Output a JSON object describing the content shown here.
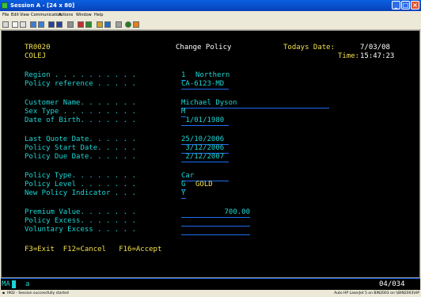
{
  "window": {
    "title": "Session A - [24 x 80]"
  },
  "menu": [
    "File",
    "Edit",
    "View",
    "Communication",
    "Actions",
    "Window",
    "Help"
  ],
  "screen": {
    "program_id": "TR0020",
    "user": "COLEJ",
    "title": "Change Policy",
    "date_label": "Todays Date:",
    "date_value": "7/03/08",
    "time_label": "Time:",
    "time_value": "15:47:23",
    "fields": {
      "region_label": "Region . . . . . . . . . .",
      "region_code": "1",
      "region_name": "Northern",
      "policy_ref_label": "Policy reference . . . . .",
      "policy_ref": "CA-6123-MD",
      "customer_label": "Customer Name. . . . . . .",
      "customer": "Michael Dyson",
      "sex_label": "Sex Type . . . . . . . . .",
      "sex": "M",
      "dob_label": "Date of Birth. . . . . . .",
      "dob": " 1/01/1980",
      "last_quote_label": "Last Quote Date. . . . . .",
      "last_quote": "25/10/2006",
      "start_label": "Policy Start Date. . . . .",
      "start": " 3/12/2006",
      "due_label": "Policy Due Date. . . . . .",
      "due": " 2/12/2007",
      "type_label": "Policy Type. . . . . . . .",
      "type": "Car",
      "level_label": "Policy Level . . . . . . .",
      "level_code": "G",
      "level_name": "GOLD",
      "new_ind_label": "New Policy Indicator . . .",
      "new_ind": "Y",
      "premium_label": "Premium Value. . . . . . .",
      "premium": "700.00",
      "excess_label": "Policy Excess. . . . . . .",
      "excess": "",
      "vol_excess_label": "Voluntary Excess . . . . .",
      "vol_excess": ""
    },
    "function_keys": "F3=Exit  F12=Cancel   F16=Accept"
  },
  "oia": {
    "mode": "MA",
    "cursor_char": "a",
    "position": "04/034"
  },
  "statusbar": {
    "left": "I902 - Session successfully started",
    "right": "Auto HP LaserJet 5 on BIN2003 on \\\\BIN2003\\HP"
  },
  "colors": {
    "background": "#000000",
    "label": "#1ed5d5",
    "header": "#f0e04a",
    "underline": "#1e6ff0"
  }
}
